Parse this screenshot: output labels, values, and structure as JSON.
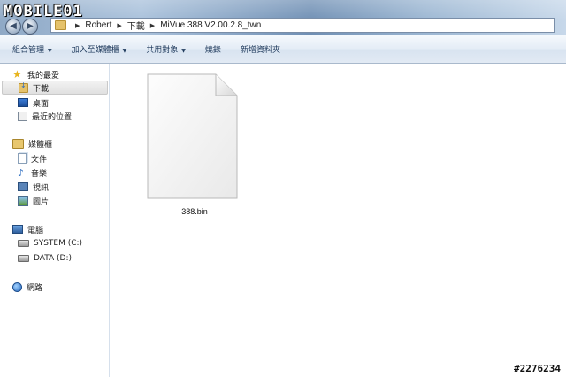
{
  "logo": {
    "text": "MOBILE01"
  },
  "address": {
    "segments": [
      "Robert",
      "下載",
      "MiVue 388 V2.00.2.8_twn"
    ]
  },
  "toolbar": {
    "organize": "組合管理",
    "add_to_library": "加入至媒體櫃",
    "share_with": "共用對象",
    "burn": "燒錄",
    "new_folder": "新增資料夾"
  },
  "nav": {
    "favorites": {
      "label": "我的最愛",
      "icon": "star-icon",
      "items": [
        {
          "label": "下載",
          "icon": "downloads-folder-icon",
          "selected": true
        },
        {
          "label": "桌面",
          "icon": "desktop-icon"
        },
        {
          "label": "最近的位置",
          "icon": "recent-places-icon"
        }
      ]
    },
    "libraries": {
      "label": "媒體櫃",
      "icon": "library-icon",
      "items": [
        {
          "label": "文件",
          "icon": "documents-icon"
        },
        {
          "label": "音樂",
          "icon": "music-icon"
        },
        {
          "label": "視訊",
          "icon": "video-icon"
        },
        {
          "label": "圖片",
          "icon": "pictures-icon"
        }
      ]
    },
    "computer": {
      "label": "電腦",
      "icon": "computer-icon",
      "items": [
        {
          "label": "SYSTEM (C:)",
          "icon": "drive-icon"
        },
        {
          "label": "DATA (D:)",
          "icon": "drive-icon"
        }
      ]
    },
    "network": {
      "label": "網路",
      "icon": "network-icon"
    }
  },
  "files": [
    {
      "name": "388.bin",
      "icon": "file-icon"
    }
  ],
  "watermark": "#2276234",
  "colors": {
    "toolbar_text": "#1e395b",
    "selection": "#e0e0e0"
  }
}
